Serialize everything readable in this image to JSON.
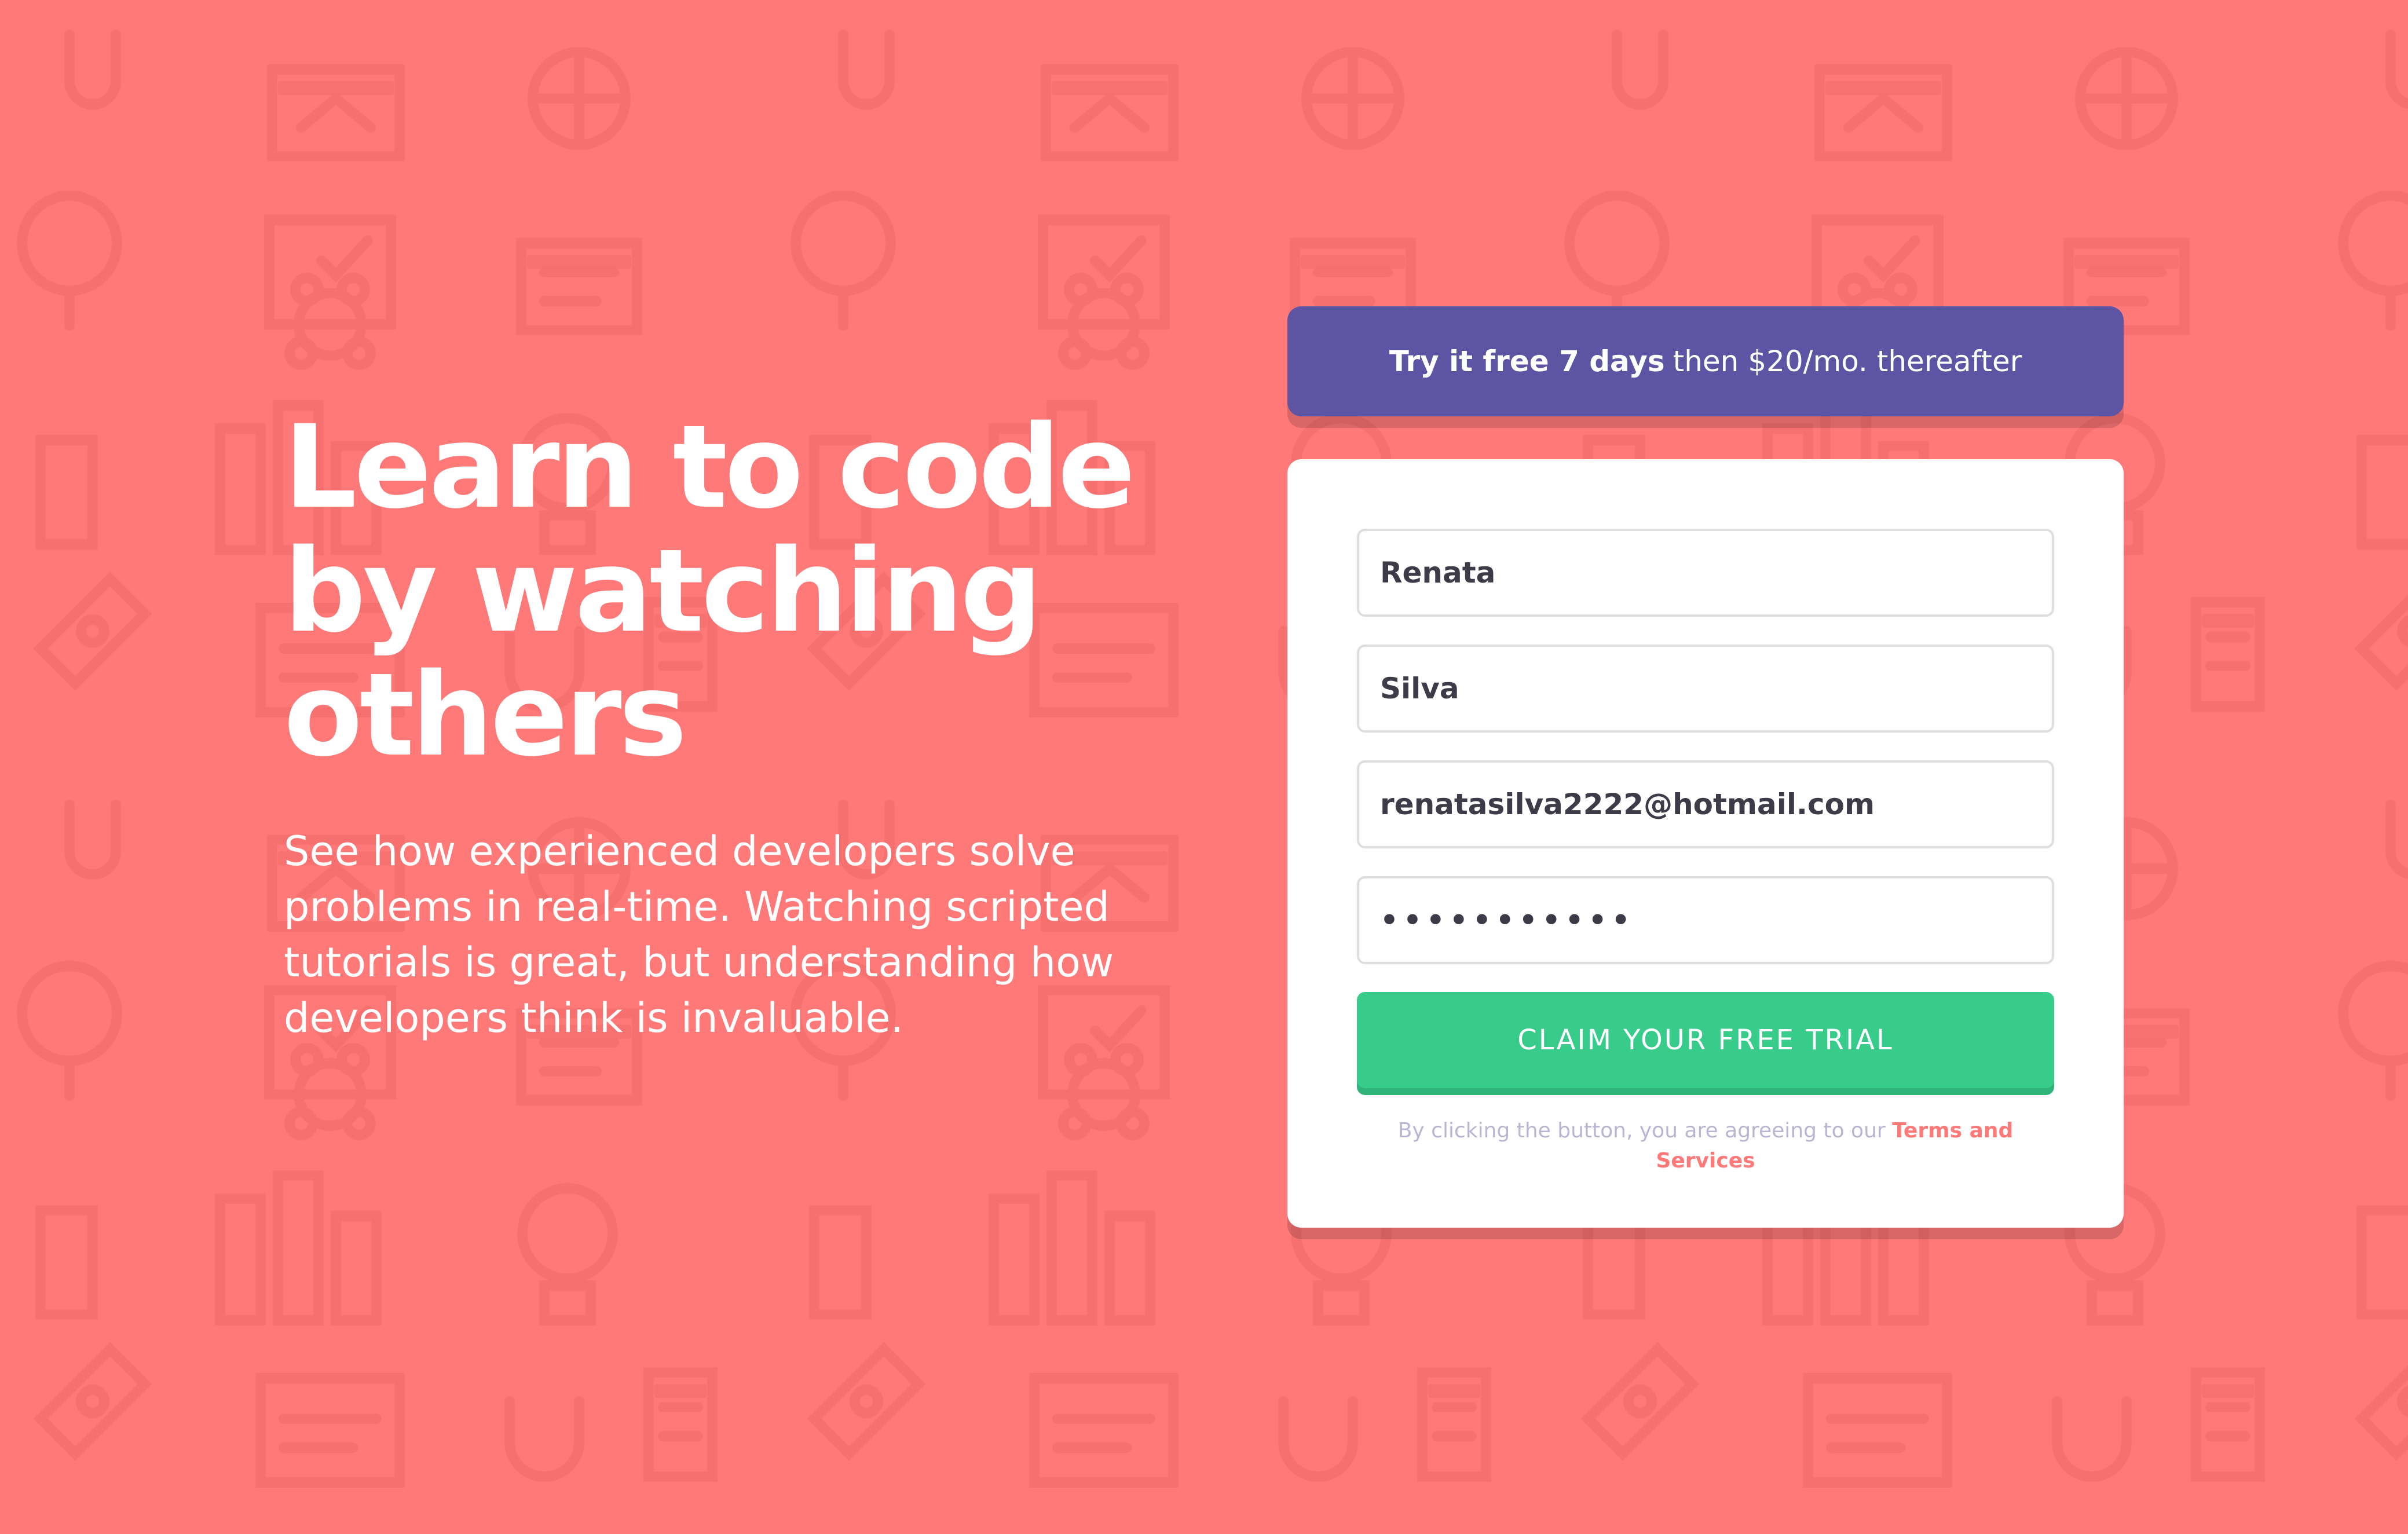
{
  "hero": {
    "title": "Learn to code by watching others",
    "description": "See how experienced developers solve problems in real-time. Watching scripted tutorials is great, but understanding how developers think is invaluable."
  },
  "offer": {
    "strong_text": "Try it free 7 days",
    "rest_text": "then $20/mo. thereafter"
  },
  "form": {
    "first_name_value": "Renata",
    "last_name_value": "Silva",
    "email_value": "renatasilva2222@hotmail.com",
    "password_value": "•••••••••••",
    "submit_label": "Claim your free trial",
    "terms_text": "By clicking the button, you are agreeing to our",
    "terms_link": "Terms and Services"
  },
  "colors": {
    "background": "#ff7979",
    "accent_purple": "#5e54a4",
    "button_green": "#38cc8b",
    "text_white": "#ffffff",
    "terms_gray": "#b9b6d3"
  },
  "icons": [
    "browser-window-icon",
    "house-icon",
    "headset-icon",
    "toolbox-icon",
    "network-icon",
    "thumbs-up-icon",
    "bar-chart-icon",
    "rocket-icon",
    "gear-globe-icon",
    "life-buoy-icon",
    "calendar-icon",
    "lightbulb-icon",
    "magnet-icon"
  ]
}
